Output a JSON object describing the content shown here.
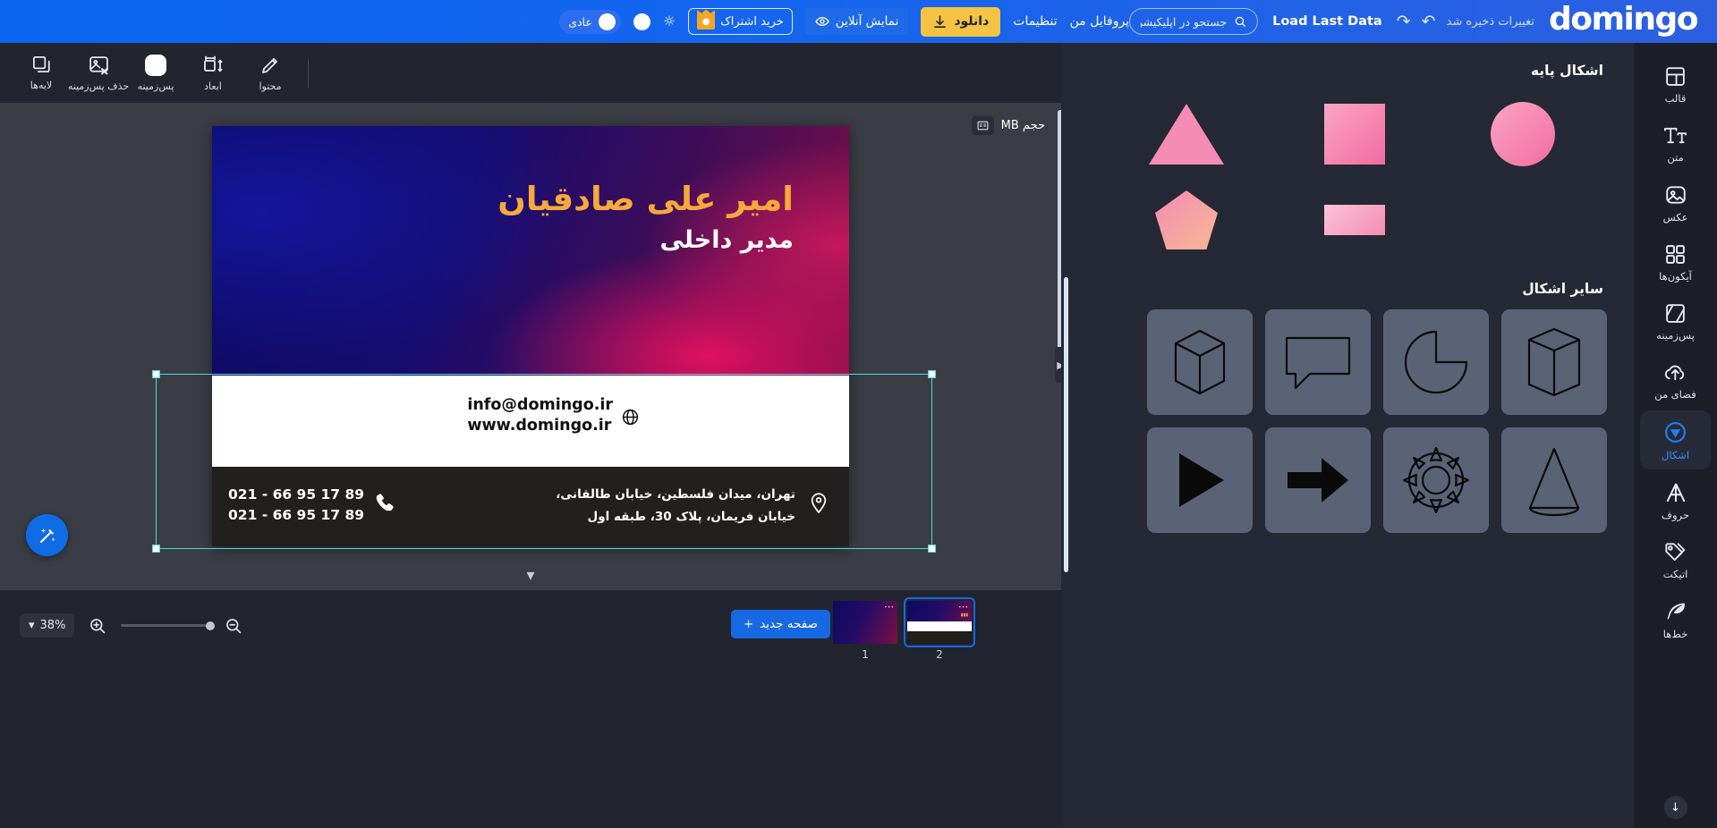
{
  "topbar": {
    "logo": "domingo",
    "saved_text": "تغییرات ذخیره شد",
    "undo_icon": "undo-icon",
    "redo_icon": "redo-icon",
    "load_last_data": "Load Last Data",
    "search_placeholder": "جستجو در اپلیکیشن...",
    "search_value": "",
    "mode_label": "عادی",
    "buy_subscription": "خرید اشتراک",
    "online_preview": "نمایش آنلاین",
    "download": "دانلود",
    "settings": "تنظیمات",
    "my_profile": "پروفایل من"
  },
  "toolbar": {
    "items": [
      {
        "label": "لایه‌ها",
        "icon": "layers-icon"
      },
      {
        "label": "حذف پس‌زمینه",
        "icon": "remove-background-icon"
      },
      {
        "label": "پس‌زمینه",
        "icon": "background-color-icon"
      },
      {
        "label": "ابعاد",
        "icon": "dimensions-icon"
      },
      {
        "label": "محتوا",
        "icon": "content-edit-icon"
      }
    ]
  },
  "canvas": {
    "size_badge": "حجم MB",
    "card": {
      "name": "امیر علی صادقیان",
      "role": "مدیر داخلی",
      "email": "info@domingo.ir",
      "website": "www.domingo.ir",
      "address_line1": "تهران، میدان فلسطین، خیابان طالقانی،",
      "address_line2": "خیابان فریمان، پلاک 30، طبقه اول",
      "phone_line1": "021 - 66 95 17 89",
      "phone_line2": "021 - 66 95 17 89"
    },
    "selection_color": "#4fd8e0",
    "magic_icon": "magic-wand-icon"
  },
  "bottombar": {
    "zoom_level": "38%",
    "zoom_in_icon": "zoom-in-icon",
    "zoom_out_icon": "zoom-out-icon",
    "new_page": "صفحه جدید",
    "pages": [
      {
        "number": "1",
        "selected": false
      },
      {
        "number": "2",
        "selected": true
      }
    ]
  },
  "shapes_panel": {
    "basic_title": "اشکال پایه",
    "basic_shapes": [
      {
        "name": "circle-shape"
      },
      {
        "name": "square-shape"
      },
      {
        "name": "triangle-shape"
      },
      {
        "name": "rectangle-shape"
      },
      {
        "name": "pentagon-shape"
      }
    ],
    "other_title": "سایر اشکال",
    "other_shapes": [
      {
        "name": "pie-slice-shape"
      },
      {
        "name": "hexagonal-prism-shape"
      },
      {
        "name": "cube-shape"
      },
      {
        "name": "speech-bubble-shape"
      },
      {
        "name": "flower-shape"
      },
      {
        "name": "cone-shape"
      },
      {
        "name": "play-triangle-shape"
      },
      {
        "name": "arrow-right-shape"
      }
    ]
  },
  "rail": {
    "items": [
      {
        "label": "قالب",
        "icon": "template-icon",
        "active": false
      },
      {
        "label": "متن",
        "icon": "text-icon",
        "active": false
      },
      {
        "label": "عکس",
        "icon": "image-icon",
        "active": false
      },
      {
        "label": "آیکون‌ها",
        "icon": "icons-grid-icon",
        "active": false
      },
      {
        "label": "پس‌زمینه",
        "icon": "background-icon",
        "active": false
      },
      {
        "label": "فضای من",
        "icon": "cloud-upload-icon",
        "active": false
      },
      {
        "label": "اشکال",
        "icon": "shapes-icon",
        "active": true
      },
      {
        "label": "حروف",
        "icon": "letters-icon",
        "active": false
      },
      {
        "label": "اتیکت",
        "icon": "tag-icon",
        "active": false
      },
      {
        "label": "خط‌ها",
        "icon": "feather-icon",
        "active": false
      }
    ],
    "scroll_down_icon": "scroll-down-icon"
  },
  "colors": {
    "brand_blue": "#1668e3",
    "accent_yellow": "#f5c342",
    "selection_cyan": "#4fd8e0",
    "panel_dark": "#252835",
    "rail_dark": "#1c1f28"
  }
}
